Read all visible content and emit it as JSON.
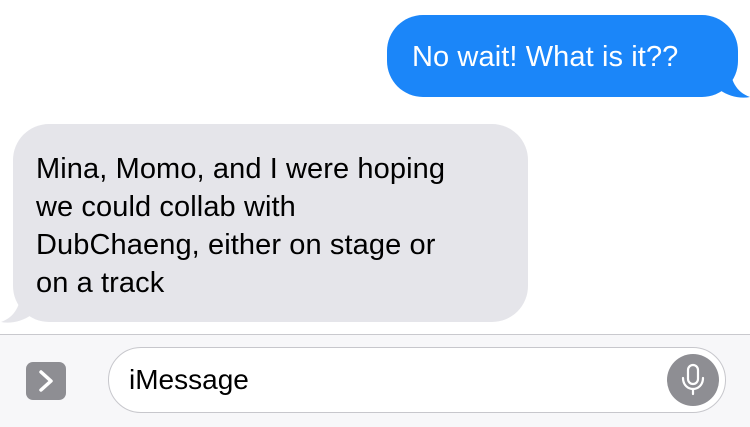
{
  "conversation": {
    "messages": [
      {
        "direction": "sent",
        "text": "No wait! What is it??",
        "bubble_color": "#1b86f9",
        "text_color": "#ffffff"
      },
      {
        "direction": "received",
        "text": "Mina, Momo, and I were hoping\nwe could collab with\nDubChaeng, either on stage or\non a track",
        "bubble_color": "#e5e5ea",
        "text_color": "#000000"
      }
    ]
  },
  "input_bar": {
    "expand_icon": "chevron-right-icon",
    "placeholder": "iMessage",
    "mic_icon": "microphone-icon",
    "background": "#f7f7f9",
    "button_color": "#8e8e93"
  }
}
